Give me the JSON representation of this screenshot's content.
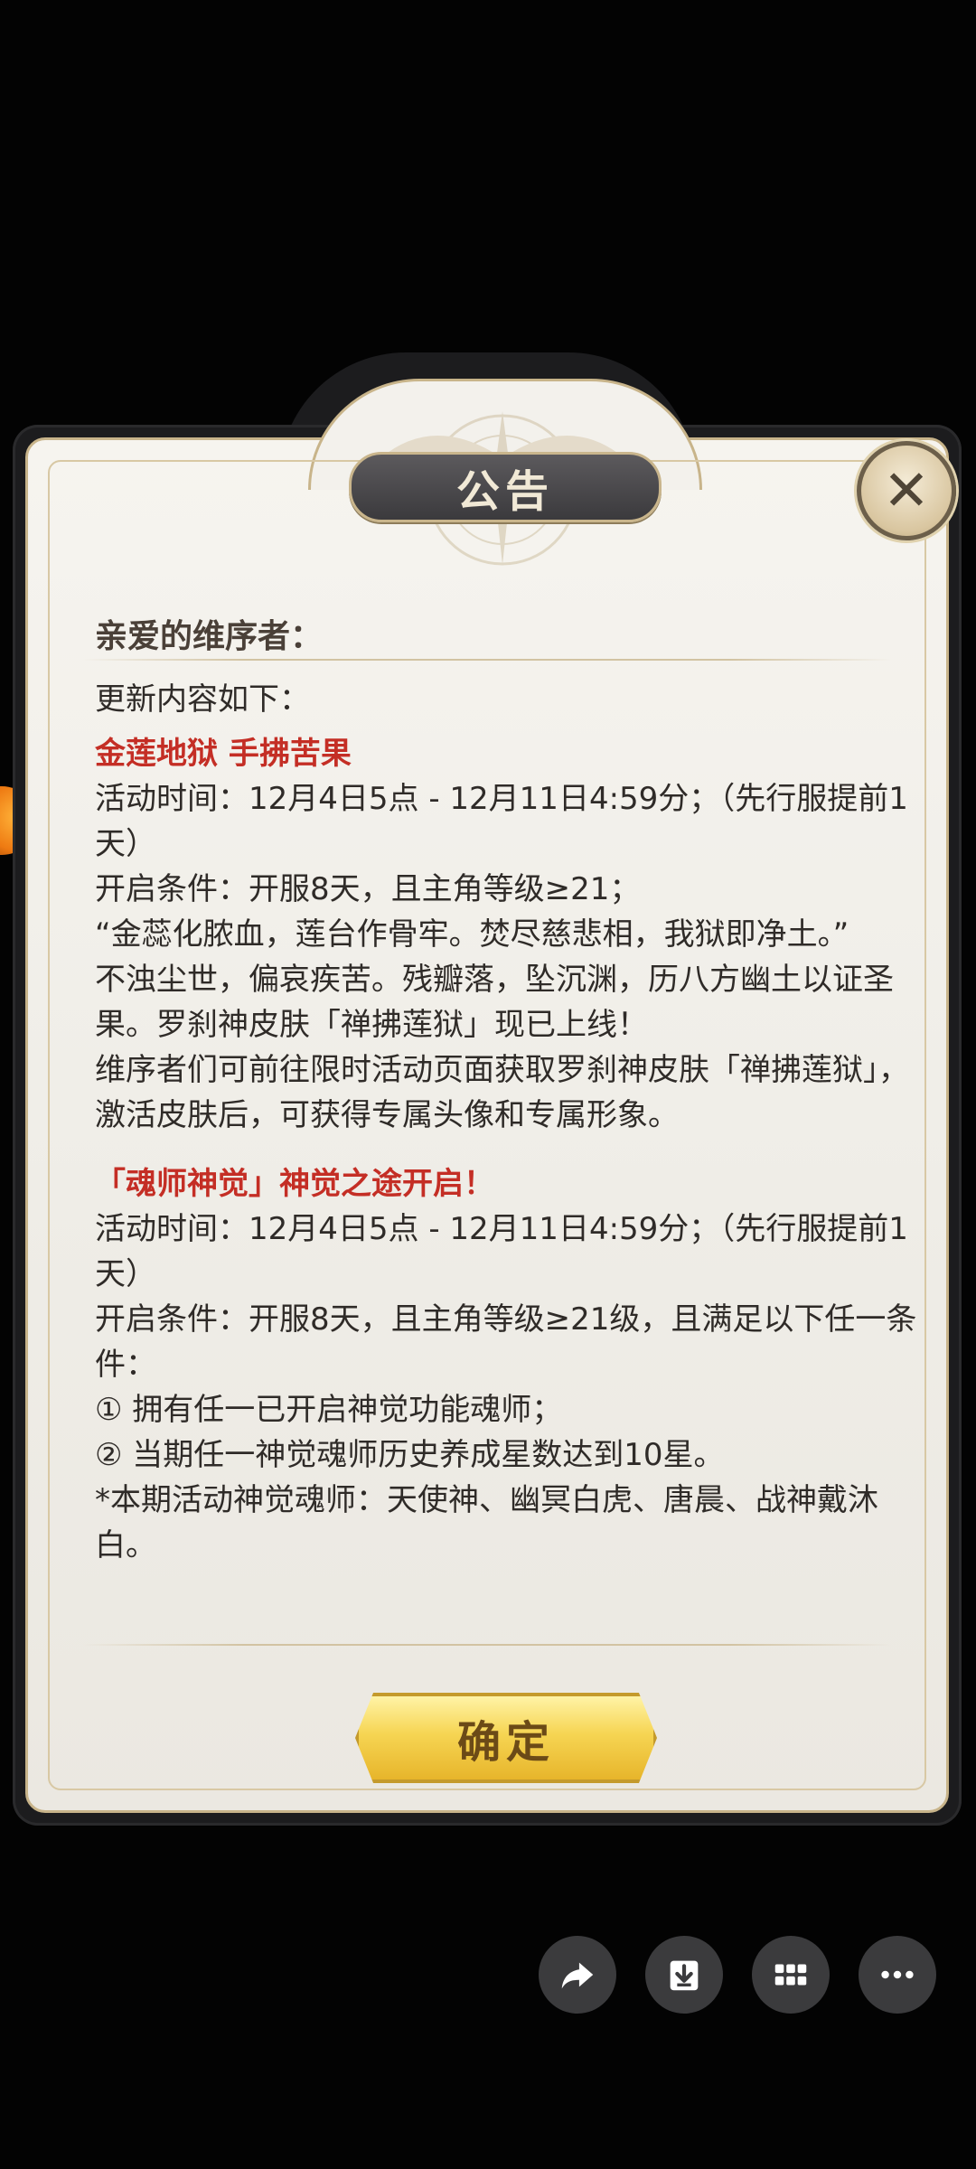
{
  "dialog": {
    "title": "公告",
    "close_icon": "close-icon",
    "greeting": "亲爱的维序者：",
    "intro": "更新内容如下：",
    "sections": [
      {
        "heading": "金莲地狱 手拂苦果",
        "lines": [
          "活动时间：12月4日5点 - 12月11日4:59分；（先行服提前1天）",
          "开启条件：开服8天，且主角等级≥21；",
          "“金蕊化脓血，莲台作骨牢。焚尽慈悲相，我狱即净土。”",
          "不浊尘世，偏哀疾苦。残瓣落，坠沉渊，历八方幽土以证圣果。罗刹神皮肤「禅拂莲狱」现已上线！",
          "维序者们可前往限时活动页面获取罗刹神皮肤「禅拂莲狱」，激活皮肤后，可获得专属头像和专属形象。"
        ]
      },
      {
        "heading": "「魂师神觉」神觉之途开启！",
        "lines": [
          "活动时间：12月4日5点 - 12月11日4:59分；（先行服提前1天）",
          "开启条件：开服8天，且主角等级≥21级，且满足以下任一条件：",
          " ① 拥有任一已开启神觉功能魂师；",
          "② 当期任一神觉魂师历史养成星数达到10星。",
          "*本期活动神觉魂师：天使神、幽冥白虎、唐晨、战神戴沐白。"
        ]
      }
    ],
    "confirm_label": "确定"
  },
  "action_bar": {
    "icons": [
      "share-icon",
      "download-icon",
      "apps-grid-icon",
      "more-icon"
    ],
    "background": "#3b3b3d"
  },
  "colors": {
    "heading_red": "#c42e25",
    "panel_bg": "#f3f1ec",
    "gold": "#f6d553"
  }
}
